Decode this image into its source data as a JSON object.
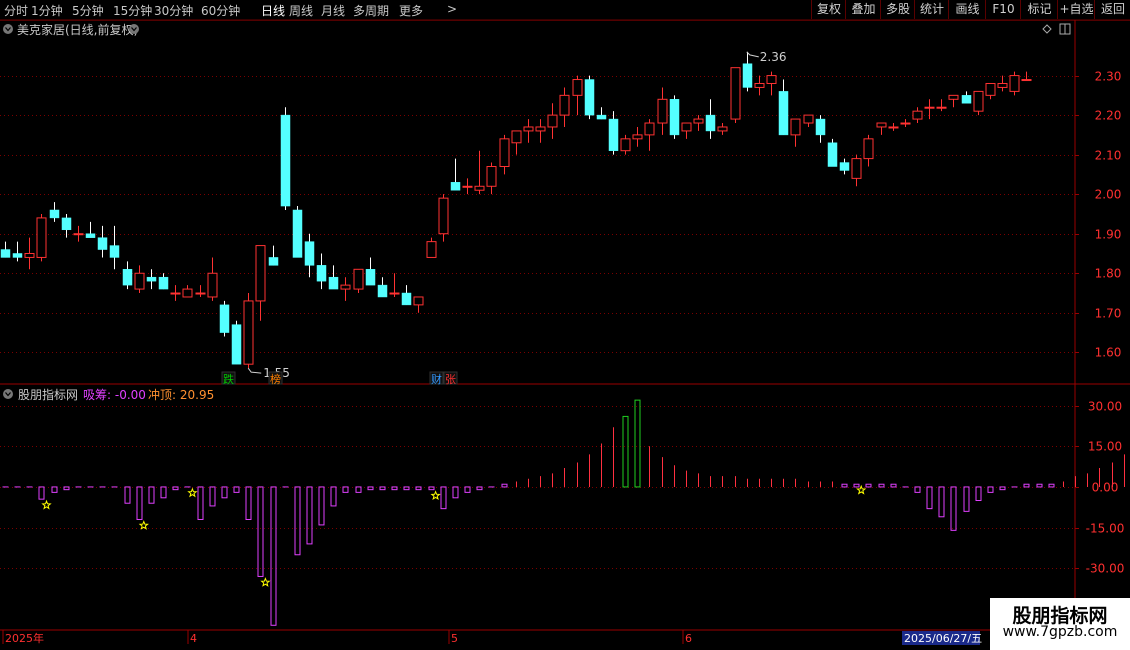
{
  "toolbar": {
    "periods": [
      "分时",
      "1分钟",
      "5分钟",
      "15分钟",
      "30分钟",
      "60分钟",
      "日线",
      "周线",
      "月线",
      "多周期",
      "更多"
    ],
    "active_period": "日线",
    "more_arrow": ">",
    "buttons": [
      "复权",
      "叠加",
      "多股",
      "统计",
      "画线",
      "F10",
      "标记",
      "+自选",
      "返回"
    ]
  },
  "main_panel": {
    "title": "美克家居(日线,前复权)",
    "high_marker": "2.36",
    "low_marker": "1.55",
    "badges": [
      {
        "text": "跌",
        "color": "#00c800"
      },
      {
        "text": "榜",
        "color": "#ff8000"
      },
      {
        "text": "财",
        "color": "#3399ff"
      },
      {
        "text": "张",
        "color": "#ff3030"
      }
    ]
  },
  "indicator_panel": {
    "name": "股朋指标网",
    "label1": "吸筹: -0.00",
    "label2": "冲顶: 20.95"
  },
  "time_axis": {
    "labels": [
      "2025年",
      "4",
      "5",
      "6"
    ],
    "current_date": "2025/06/27/五"
  },
  "watermark": {
    "title": "股朋指标网",
    "url": "www.7gpzb.com"
  },
  "colors": {
    "up": "#ff3232",
    "down": "#54ffff",
    "grid": "#7a0000",
    "indicator": "#e040ff",
    "indicator_peak": "#20d020",
    "star": "#ffff00"
  },
  "chart_data": {
    "type": "candlestick",
    "price_axis": {
      "ticks": [
        1.6,
        1.7,
        1.8,
        1.9,
        2.0,
        2.1,
        2.2,
        2.3
      ],
      "range": [
        1.53,
        2.39
      ]
    },
    "indicator_axis": {
      "ticks": [
        30.0,
        15.0,
        0.0,
        -15.0,
        -30.0
      ],
      "range": [
        -52,
        35
      ]
    },
    "candles": [
      [
        1.86,
        1.88,
        1.84,
        1.84
      ],
      [
        1.85,
        1.88,
        1.83,
        1.84
      ],
      [
        1.84,
        1.89,
        1.81,
        1.85
      ],
      [
        1.84,
        1.95,
        1.83,
        1.94
      ],
      [
        1.96,
        1.98,
        1.93,
        1.94
      ],
      [
        1.94,
        1.95,
        1.89,
        1.91
      ],
      [
        1.9,
        1.92,
        1.88,
        1.9
      ],
      [
        1.9,
        1.93,
        1.89,
        1.89
      ],
      [
        1.89,
        1.92,
        1.84,
        1.86
      ],
      [
        1.87,
        1.92,
        1.81,
        1.84
      ],
      [
        1.81,
        1.83,
        1.76,
        1.77
      ],
      [
        1.76,
        1.82,
        1.75,
        1.8
      ],
      [
        1.79,
        1.81,
        1.76,
        1.78
      ],
      [
        1.79,
        1.8,
        1.76,
        1.76
      ],
      [
        1.75,
        1.77,
        1.73,
        1.75
      ],
      [
        1.74,
        1.77,
        1.74,
        1.76
      ],
      [
        1.75,
        1.77,
        1.74,
        1.75
      ],
      [
        1.74,
        1.84,
        1.73,
        1.8
      ],
      [
        1.72,
        1.73,
        1.64,
        1.65
      ],
      [
        1.67,
        1.68,
        1.57,
        1.57
      ],
      [
        1.57,
        1.75,
        1.56,
        1.73
      ],
      [
        1.73,
        1.74,
        1.68,
        1.87
      ],
      [
        1.84,
        1.87,
        1.82,
        1.82
      ],
      [
        2.2,
        2.22,
        1.96,
        1.97
      ],
      [
        1.96,
        1.97,
        1.86,
        1.84
      ],
      [
        1.88,
        1.9,
        1.79,
        1.82
      ],
      [
        1.82,
        1.85,
        1.76,
        1.78
      ],
      [
        1.79,
        1.82,
        1.77,
        1.76
      ],
      [
        1.76,
        1.79,
        1.73,
        1.77
      ],
      [
        1.76,
        1.81,
        1.75,
        1.81
      ],
      [
        1.81,
        1.84,
        1.79,
        1.77
      ],
      [
        1.77,
        1.79,
        1.74,
        1.74
      ],
      [
        1.75,
        1.8,
        1.74,
        1.75
      ],
      [
        1.75,
        1.77,
        1.72,
        1.72
      ],
      [
        1.72,
        1.74,
        1.7,
        1.74
      ],
      [
        1.84,
        1.89,
        1.84,
        1.88
      ],
      [
        1.9,
        2.0,
        1.88,
        1.99
      ],
      [
        2.03,
        2.09,
        2.01,
        2.01
      ],
      [
        2.02,
        2.04,
        2.0,
        2.02
      ],
      [
        2.01,
        2.11,
        2.0,
        2.02
      ],
      [
        2.02,
        2.08,
        2.0,
        2.07
      ],
      [
        2.07,
        2.15,
        2.05,
        2.14
      ],
      [
        2.13,
        2.16,
        2.1,
        2.16
      ],
      [
        2.16,
        2.19,
        2.13,
        2.17
      ],
      [
        2.16,
        2.19,
        2.13,
        2.17
      ],
      [
        2.17,
        2.23,
        2.14,
        2.2
      ],
      [
        2.2,
        2.27,
        2.17,
        2.25
      ],
      [
        2.25,
        2.3,
        2.2,
        2.29
      ],
      [
        2.29,
        2.3,
        2.19,
        2.2
      ],
      [
        2.2,
        2.22,
        2.19,
        2.19
      ],
      [
        2.19,
        2.21,
        2.1,
        2.11
      ],
      [
        2.11,
        2.15,
        2.1,
        2.14
      ],
      [
        2.14,
        2.17,
        2.12,
        2.15
      ],
      [
        2.15,
        2.19,
        2.11,
        2.18
      ],
      [
        2.18,
        2.27,
        2.15,
        2.24
      ],
      [
        2.24,
        2.25,
        2.14,
        2.15
      ],
      [
        2.16,
        2.18,
        2.14,
        2.18
      ],
      [
        2.18,
        2.2,
        2.16,
        2.19
      ],
      [
        2.2,
        2.24,
        2.14,
        2.16
      ],
      [
        2.16,
        2.18,
        2.15,
        2.17
      ],
      [
        2.19,
        2.32,
        2.18,
        2.32
      ],
      [
        2.33,
        2.36,
        2.26,
        2.27
      ],
      [
        2.27,
        2.3,
        2.25,
        2.28
      ],
      [
        2.28,
        2.31,
        2.25,
        2.3
      ],
      [
        2.26,
        2.29,
        2.15,
        2.15
      ],
      [
        2.15,
        2.18,
        2.12,
        2.19
      ],
      [
        2.18,
        2.2,
        2.17,
        2.2
      ],
      [
        2.19,
        2.2,
        2.13,
        2.15
      ],
      [
        2.13,
        2.14,
        2.07,
        2.07
      ],
      [
        2.08,
        2.09,
        2.05,
        2.06
      ],
      [
        2.04,
        2.1,
        2.02,
        2.09
      ],
      [
        2.09,
        2.15,
        2.07,
        2.14
      ],
      [
        2.17,
        2.18,
        2.15,
        2.18
      ],
      [
        2.17,
        2.18,
        2.16,
        2.17
      ],
      [
        2.18,
        2.19,
        2.17,
        2.18
      ],
      [
        2.19,
        2.22,
        2.18,
        2.21
      ],
      [
        2.22,
        2.24,
        2.19,
        2.22
      ],
      [
        2.22,
        2.24,
        2.21,
        2.22
      ],
      [
        2.24,
        2.25,
        2.22,
        2.25
      ],
      [
        2.25,
        2.26,
        2.23,
        2.23
      ],
      [
        2.21,
        2.26,
        2.2,
        2.26
      ],
      [
        2.25,
        2.28,
        2.24,
        2.28
      ],
      [
        2.27,
        2.3,
        2.26,
        2.28
      ],
      [
        2.26,
        2.31,
        2.25,
        2.3
      ],
      [
        2.29,
        2.31,
        2.29,
        2.29
      ]
    ],
    "indicator": [
      0,
      0,
      0,
      -4.5,
      -2,
      -1,
      0,
      0,
      0,
      0,
      -6,
      -12,
      -6,
      -4,
      -1,
      0,
      -12,
      -7,
      -4,
      -2,
      -12,
      -33,
      -51,
      0,
      -25,
      -21,
      -14,
      -7,
      -2,
      -2,
      -1,
      -1,
      -1,
      -1,
      -1,
      -1,
      -8,
      -4,
      -2,
      -1,
      0,
      1,
      2,
      3,
      4,
      5,
      7,
      9,
      12,
      16,
      22,
      26,
      32,
      15,
      11,
      8,
      6,
      5,
      4,
      4,
      4,
      3,
      3,
      3,
      3,
      3,
      2,
      2,
      2,
      1,
      1,
      1,
      1,
      1,
      0,
      -2,
      -8,
      -11,
      -16,
      -9,
      -5,
      -2,
      -1,
      0,
      1,
      1,
      1,
      2,
      4,
      5,
      7,
      9,
      12,
      16,
      21
    ],
    "stars": [
      3,
      11,
      15,
      21,
      35,
      70
    ]
  }
}
